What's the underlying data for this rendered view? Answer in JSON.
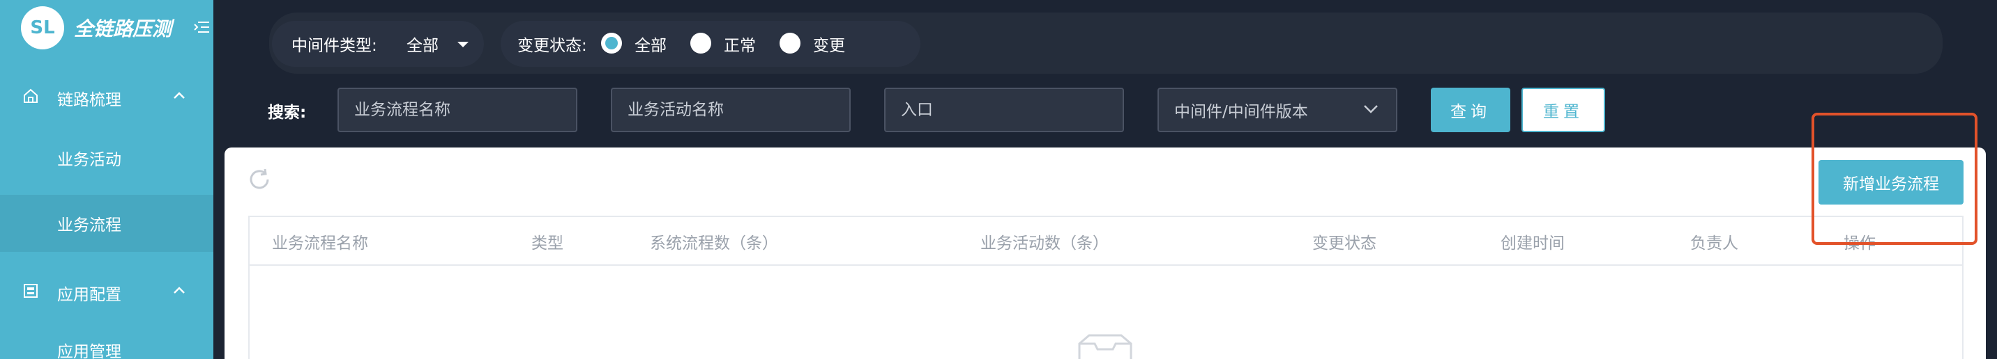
{
  "brand": {
    "logo_text": "SL",
    "title": "全链路压测"
  },
  "sidebar": {
    "groups": [
      {
        "label": "链路梳理",
        "items": [
          {
            "label": "业务活动"
          },
          {
            "label": "业务流程",
            "active": true
          }
        ]
      },
      {
        "label": "应用配置",
        "items": [
          {
            "label": "应用管理"
          }
        ]
      }
    ]
  },
  "filters": {
    "middleware_type_label": "中间件类型:",
    "middleware_type_value": "全部",
    "change_status_label": "变更状态:",
    "status_options": [
      {
        "label": "全部",
        "checked": true
      },
      {
        "label": "正常",
        "checked": false
      },
      {
        "label": "变更",
        "checked": false
      }
    ],
    "search_label": "搜索:",
    "process_name_placeholder": "业务流程名称",
    "activity_name_placeholder": "业务活动名称",
    "entry_placeholder": "入口",
    "middleware_version_placeholder": "中间件/中间件版本",
    "query_button": "查询",
    "reset_button": "重置"
  },
  "toolbar": {
    "add_button": "新增业务流程"
  },
  "table": {
    "columns": [
      "业务流程名称",
      "类型",
      "系统流程数（条）",
      "业务活动数（条）",
      "变更状态",
      "创建时间",
      "负责人",
      "操作"
    ]
  },
  "colors": {
    "accent": "#4eb5cf",
    "highlight": "#e2522a",
    "dark_bg": "#1c2433"
  }
}
